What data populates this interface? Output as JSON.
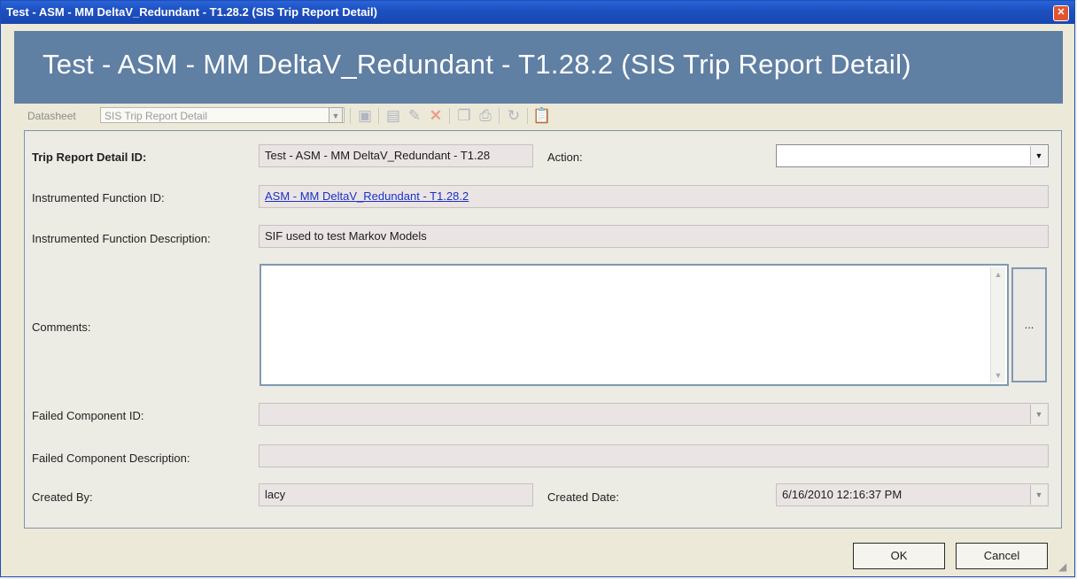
{
  "window": {
    "title": "Test - ASM - MM DeltaV_Redundant - T1.28.2 (SIS Trip Report Detail)",
    "close_glyph": "✕"
  },
  "header": {
    "title": "Test - ASM - MM DeltaV_Redundant - T1.28.2 (SIS Trip Report Detail)"
  },
  "toolbar": {
    "datasheet_label": "Datasheet",
    "datasheet_value": "SIS Trip Report Detail",
    "icons": [
      "new-icon",
      "save-icon",
      "save-as-icon",
      "delete-icon",
      "copy-icon",
      "print-icon",
      "refresh-icon",
      "clipboard-icon"
    ]
  },
  "form": {
    "trip_report_detail_id_label": "Trip Report Detail ID:",
    "trip_report_detail_id_value": "Test - ASM - MM DeltaV_Redundant - T1.28",
    "action_label": "Action:",
    "action_value": "",
    "instrumented_function_id_label": "Instrumented Function ID:",
    "instrumented_function_id_value": "ASM - MM DeltaV_Redundant - T1.28.2",
    "instrumented_function_description_label": "Instrumented Function Description:",
    "instrumented_function_description_value": "SIF used to test Markov Models",
    "comments_label": "Comments:",
    "comments_value": "",
    "comments_ellipsis": "...",
    "failed_component_id_label": "Failed Component ID:",
    "failed_component_id_value": "",
    "failed_component_description_label": "Failed Component Description:",
    "failed_component_description_value": "",
    "created_by_label": "Created By:",
    "created_by_value": "lacy",
    "created_date_label": "Created Date:",
    "created_date_value": "6/16/2010 12:16:37 PM"
  },
  "buttons": {
    "ok": "OK",
    "cancel": "Cancel"
  },
  "colors": {
    "title_bar": "#1c4fc0",
    "header_band": "#5f7fa3",
    "readonly_field": "#ebe4e4",
    "link": "#1a33c8"
  }
}
